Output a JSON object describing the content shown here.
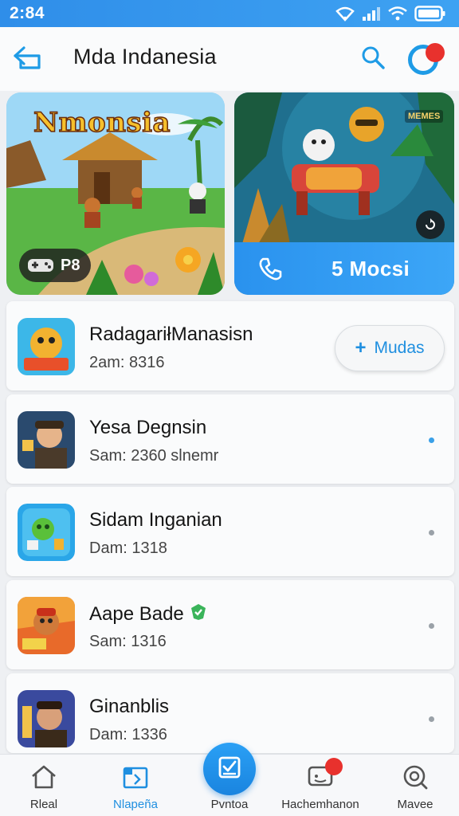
{
  "status": {
    "time": "2:84"
  },
  "header": {
    "title": "Mda Indanesia"
  },
  "banners": [
    {
      "title": "Nmonsia",
      "badge": "P8",
      "tag": "MEMES"
    },
    {
      "cta": "5 Mocsi"
    }
  ],
  "list": [
    {
      "title": "RadagariłManasisn",
      "subtitle": "2am: 8316",
      "action": "Mudas"
    },
    {
      "title": "Yesa Degnsin",
      "subtitle": "Sam: 2360 slnemr"
    },
    {
      "title": "Sidam Inganian",
      "subtitle": "Dam: 1318"
    },
    {
      "title": "Aape Bade",
      "subtitle": "Sam: 1316"
    },
    {
      "title": "Ginanblis",
      "subtitle": "Dam: 1336"
    }
  ],
  "nav": [
    {
      "label": "Rleal"
    },
    {
      "label": "Nlapeña"
    },
    {
      "label": "Pvntoa"
    },
    {
      "label": "Hachemhanon"
    },
    {
      "label": "Mavee"
    }
  ],
  "colors": {
    "accent": "#1f8fe0",
    "notification": "#e8312d"
  },
  "icons": [
    "home-icon",
    "grid-icon",
    "gift-icon",
    "message-icon",
    "search-icon",
    "back-icon",
    "wifi-icon",
    "signal-icon",
    "battery-icon",
    "phone-icon"
  ]
}
